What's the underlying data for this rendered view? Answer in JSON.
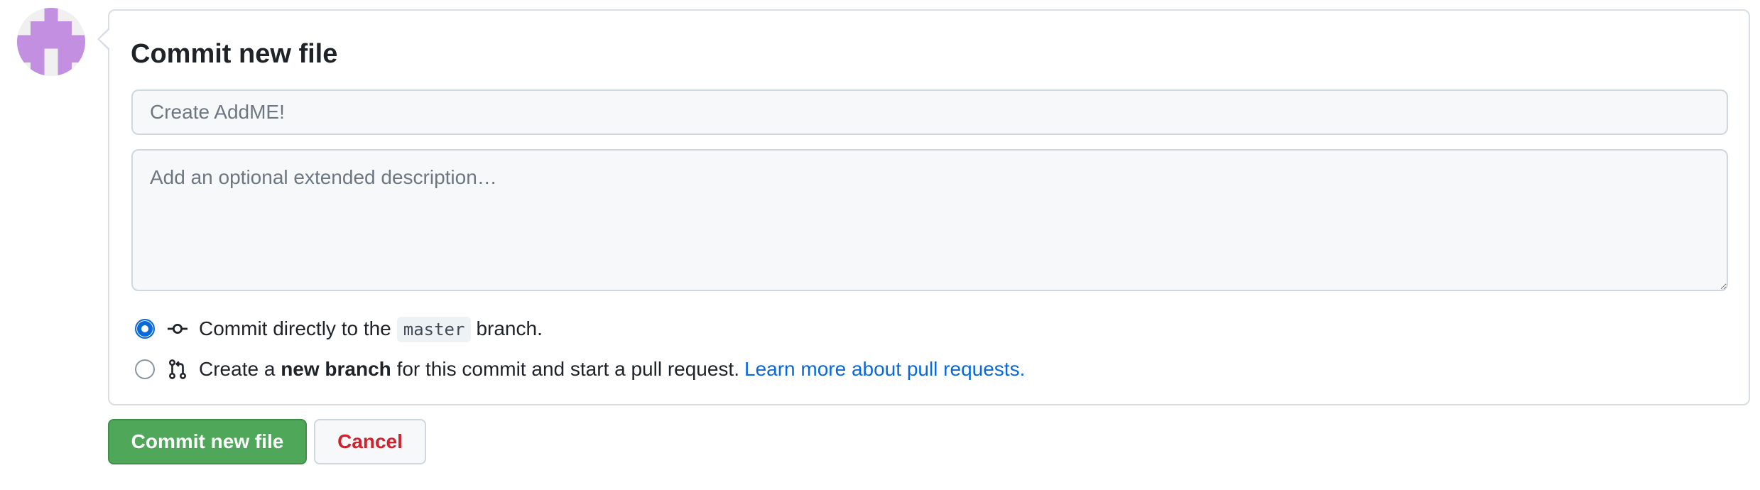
{
  "form": {
    "title": "Commit new file",
    "summary_placeholder": "Create AddME!",
    "description_placeholder": "Add an optional extended description…"
  },
  "options": {
    "direct": {
      "selected": true,
      "text_before": "Commit directly to the",
      "branch_name": "master",
      "text_after": "branch."
    },
    "new_branch": {
      "selected": false,
      "text_before": "Create a",
      "text_bold": "new branch",
      "text_after": "for this commit and start a pull request.",
      "link_text": "Learn more about pull requests."
    }
  },
  "buttons": {
    "commit_label": "Commit new file",
    "cancel_label": "Cancel"
  },
  "colors": {
    "primary_button": "#4fa75a",
    "cancel_text": "#cf222e",
    "link": "#0969da",
    "avatar": "#c38fe0"
  },
  "icons": {
    "direct_option": "git-commit-icon",
    "new_branch_option": "git-pull-request-icon"
  }
}
